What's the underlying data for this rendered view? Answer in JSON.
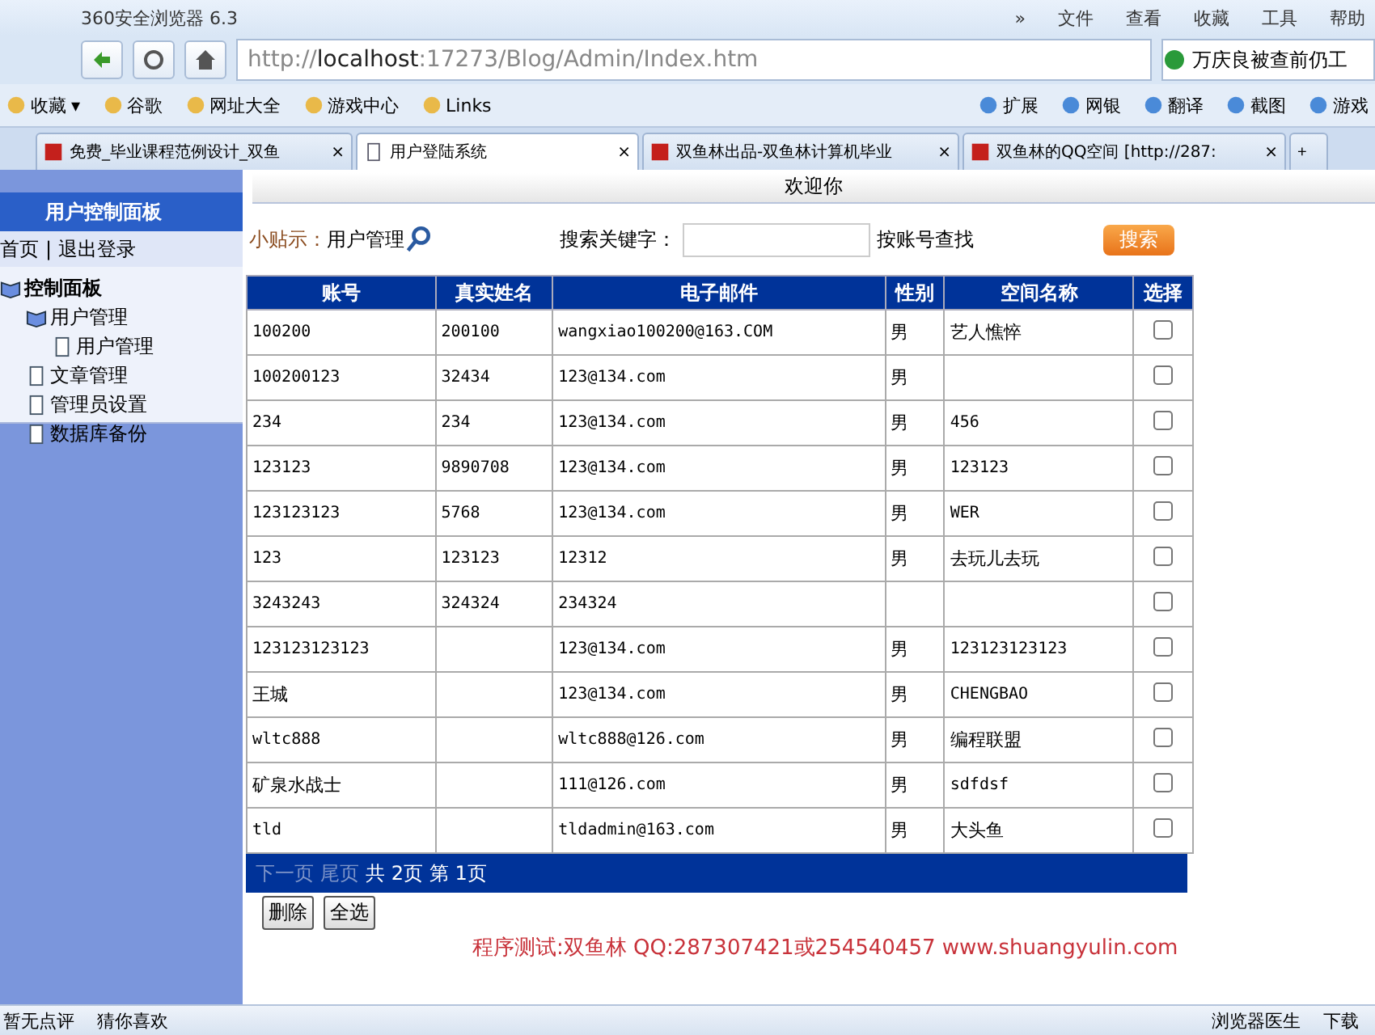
{
  "browser": {
    "title": "360安全浏览器 6.3",
    "menu": [
      "»",
      "文件",
      "查看",
      "收藏",
      "工具",
      "帮助"
    ],
    "address": {
      "scheme": "http://",
      "host": "localhost",
      "rest": ":17273/Blog/Admin/Index.htm"
    },
    "search_value": "万庆良被查前仍工",
    "caret": "▾",
    "close": "×",
    "bookmarks": [
      {
        "label": "收藏",
        "caret": true
      },
      {
        "label": "谷歌",
        "caret": false
      },
      {
        "label": "网址大全",
        "caret": false
      },
      {
        "label": "游戏中心",
        "caret": false
      },
      {
        "label": "Links",
        "caret": false
      }
    ],
    "tools": [
      "扩展",
      "网银",
      "翻译",
      "截图",
      "游戏"
    ],
    "tabs": [
      {
        "title": "免费_毕业课程范例设计_双鱼",
        "selected": false
      },
      {
        "title": "用户登陆系统",
        "selected": true
      },
      {
        "title": "双鱼林出品-双鱼林计算机毕业",
        "selected": false
      },
      {
        "title": "双鱼林的QQ空间 [http://287:",
        "selected": false
      }
    ],
    "new_tab": "+",
    "status_left": [
      "暂无点评",
      "猜你喜欢"
    ],
    "status_right": [
      "浏览器医生",
      "下载"
    ]
  },
  "sidebar": {
    "title": "用户控制面板",
    "links": [
      "首页",
      "退出登录"
    ],
    "separator": "|",
    "tree": [
      {
        "label": "控制面板",
        "expanded": true,
        "children": [
          {
            "label": "用户管理",
            "expanded": true,
            "children": [
              {
                "label": "用户管理"
              }
            ]
          },
          {
            "label": "文章管理"
          },
          {
            "label": "管理员设置"
          },
          {
            "label": "数据库备份"
          }
        ]
      }
    ]
  },
  "header": {
    "welcome": "欢迎你"
  },
  "toolbar": {
    "tip_label": "小贴示：",
    "tip_value": "用户管理",
    "search_label": "搜索关键字：",
    "search_hint": "按账号查找",
    "search_button": "搜索"
  },
  "table": {
    "columns": [
      "账号",
      "真实姓名",
      "电子邮件",
      "性别",
      "空间名称",
      "选择"
    ],
    "rows": [
      {
        "cells": [
          "100200",
          "200100",
          "wangxiao100200@163.COM",
          "男",
          "艺人憔悴"
        ],
        "checked": false
      },
      {
        "cells": [
          "100200123",
          "32434",
          "123@134.com",
          "男",
          ""
        ],
        "checked": false
      },
      {
        "cells": [
          "234",
          "234",
          "123@134.com",
          "男",
          "456"
        ],
        "checked": false
      },
      {
        "cells": [
          "123123",
          "9890708",
          "123@134.com",
          "男",
          "123123"
        ],
        "checked": false
      },
      {
        "cells": [
          "123123123",
          "5768",
          "123@134.com",
          "男",
          "WER"
        ],
        "checked": false
      },
      {
        "cells": [
          "123",
          "123123",
          "12312",
          "男",
          "去玩儿去玩"
        ],
        "checked": false
      },
      {
        "cells": [
          "3243243",
          "324324",
          "234324",
          "",
          ""
        ],
        "checked": false
      },
      {
        "cells": [
          "123123123123",
          "",
          "123@134.com",
          "男",
          "123123123123"
        ],
        "checked": false
      },
      {
        "cells": [
          "王城",
          "",
          "123@134.com",
          "男",
          "CHENGBAO"
        ],
        "checked": false
      },
      {
        "cells": [
          "wltc888",
          "",
          "wltc888@126.com",
          "男",
          "编程联盟"
        ],
        "checked": false
      },
      {
        "cells": [
          "矿泉水战士",
          "",
          "111@126.com",
          "男",
          "sdfdsf"
        ],
        "checked": false
      },
      {
        "cells": [
          "tld",
          "",
          "tldadmin@163.com",
          "男",
          "大头鱼"
        ],
        "checked": false
      }
    ],
    "pager": {
      "next": "下一页",
      "last": "尾页",
      "total": "共 2页",
      "current": "第 1页"
    }
  },
  "actions": [
    "删除",
    "全选"
  ],
  "credit": "程序测试:双鱼林 QQ:287307421或254540457 www.shuangyulin.com"
}
